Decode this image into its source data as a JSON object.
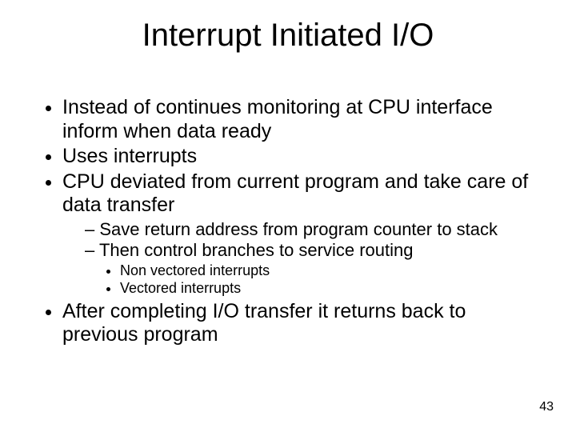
{
  "title": "Interrupt Initiated I/O",
  "bullets": {
    "b1": "Instead of continues monitoring at CPU interface inform when data ready",
    "b2": "Uses interrupts",
    "b3": "CPU deviated from current program and take care of data transfer",
    "b3_1": "Save return address from program counter to stack",
    "b3_2": "Then control branches to service routing",
    "b3_2_1": "Non vectored interrupts",
    "b3_2_2": "Vectored interrupts",
    "b4": "After completing I/O transfer it returns back to previous program"
  },
  "page_number": "43"
}
